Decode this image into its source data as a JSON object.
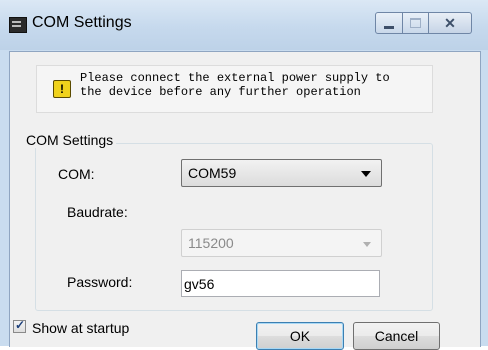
{
  "window": {
    "title": "COM Settings"
  },
  "notice": {
    "icon": "warning-icon",
    "icon_glyph": "!",
    "text": "Please connect the external power supply to\nthe device before any further operation"
  },
  "group": {
    "title": "COM Settings",
    "com_label": "COM:",
    "com_value": "COM59",
    "baudrate_label": "Baudrate:",
    "baudrate_value": "115200",
    "password_label": "Password:",
    "password_value": "gv56"
  },
  "footer": {
    "show_startup_label": "Show at startup",
    "show_startup_checked": true,
    "ok_label": "OK",
    "cancel_label": "Cancel"
  },
  "colors": {
    "titlebar": "#c6d9ed",
    "client": "#f0f0f0",
    "warning": "#f0d21c"
  }
}
